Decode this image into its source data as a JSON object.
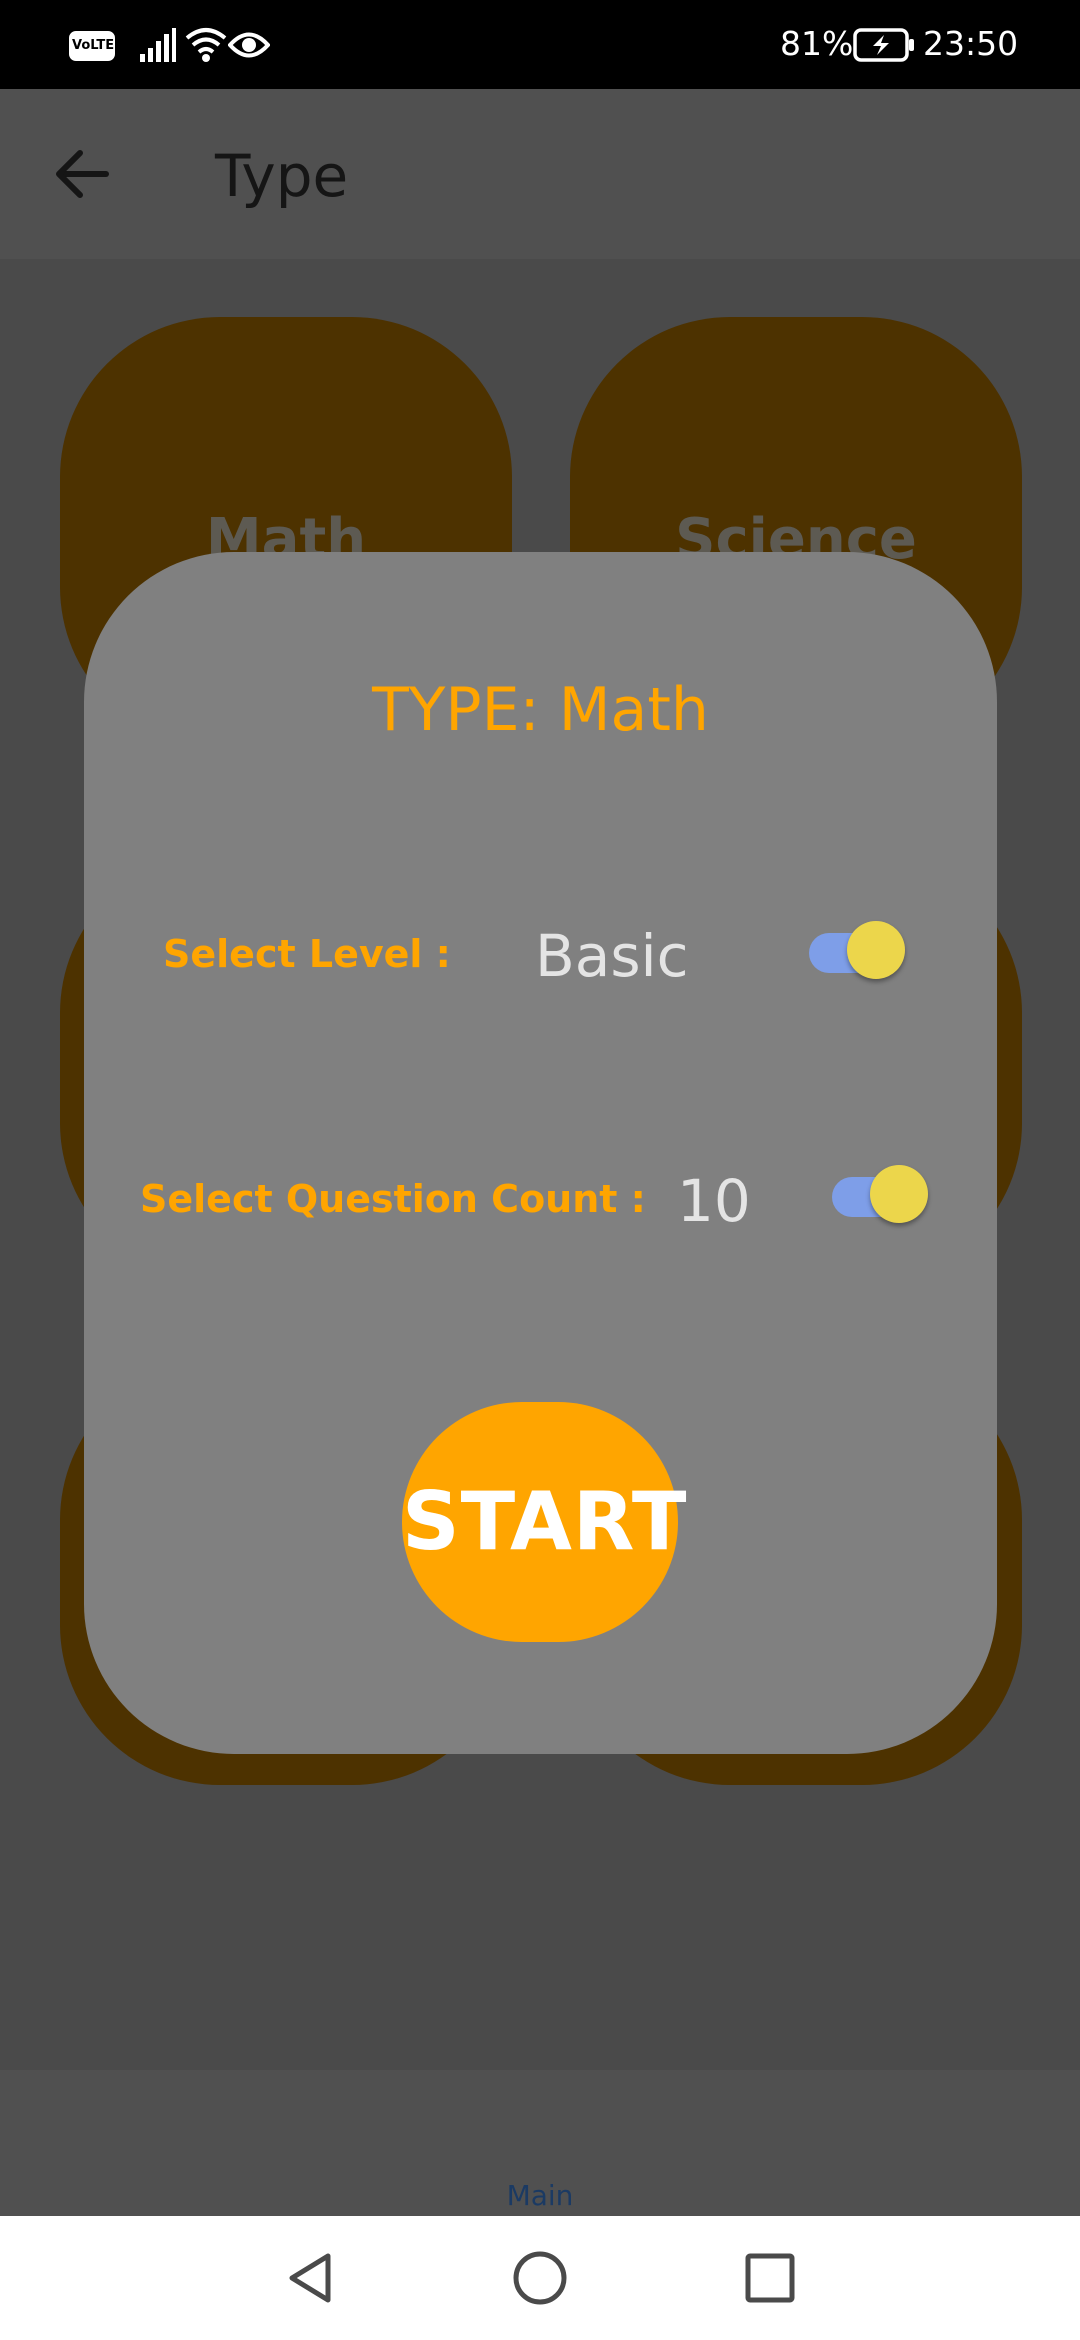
{
  "status_bar": {
    "network_badge": "VoLTE",
    "battery_percent": "81%",
    "time": "23:50",
    "icons": [
      "signal-icon",
      "wifi-icon",
      "eye-icon",
      "battery-charging-icon"
    ]
  },
  "app_bar": {
    "back_icon": "arrow-left-icon",
    "title": "Type"
  },
  "background_cards": [
    {
      "label": "Math"
    },
    {
      "label": "Science"
    }
  ],
  "dialog": {
    "title": "TYPE: Math",
    "level": {
      "label": "Select Level :",
      "value": "Basic",
      "toggle_on": true
    },
    "question_count": {
      "label": "Select Question Count :",
      "value": "10",
      "toggle_on": true
    },
    "start_label": "START"
  },
  "bottom_tab": {
    "label": "Main"
  },
  "nav_bar": {
    "icons": [
      "back-triangle-icon",
      "home-circle-icon",
      "recents-square-icon"
    ]
  },
  "colors": {
    "accent": "#ffa500",
    "card_bg": "#4d3200",
    "dialog_bg": "#808080",
    "toggle_track": "#7e9ee8",
    "toggle_thumb": "#ecd64b"
  }
}
